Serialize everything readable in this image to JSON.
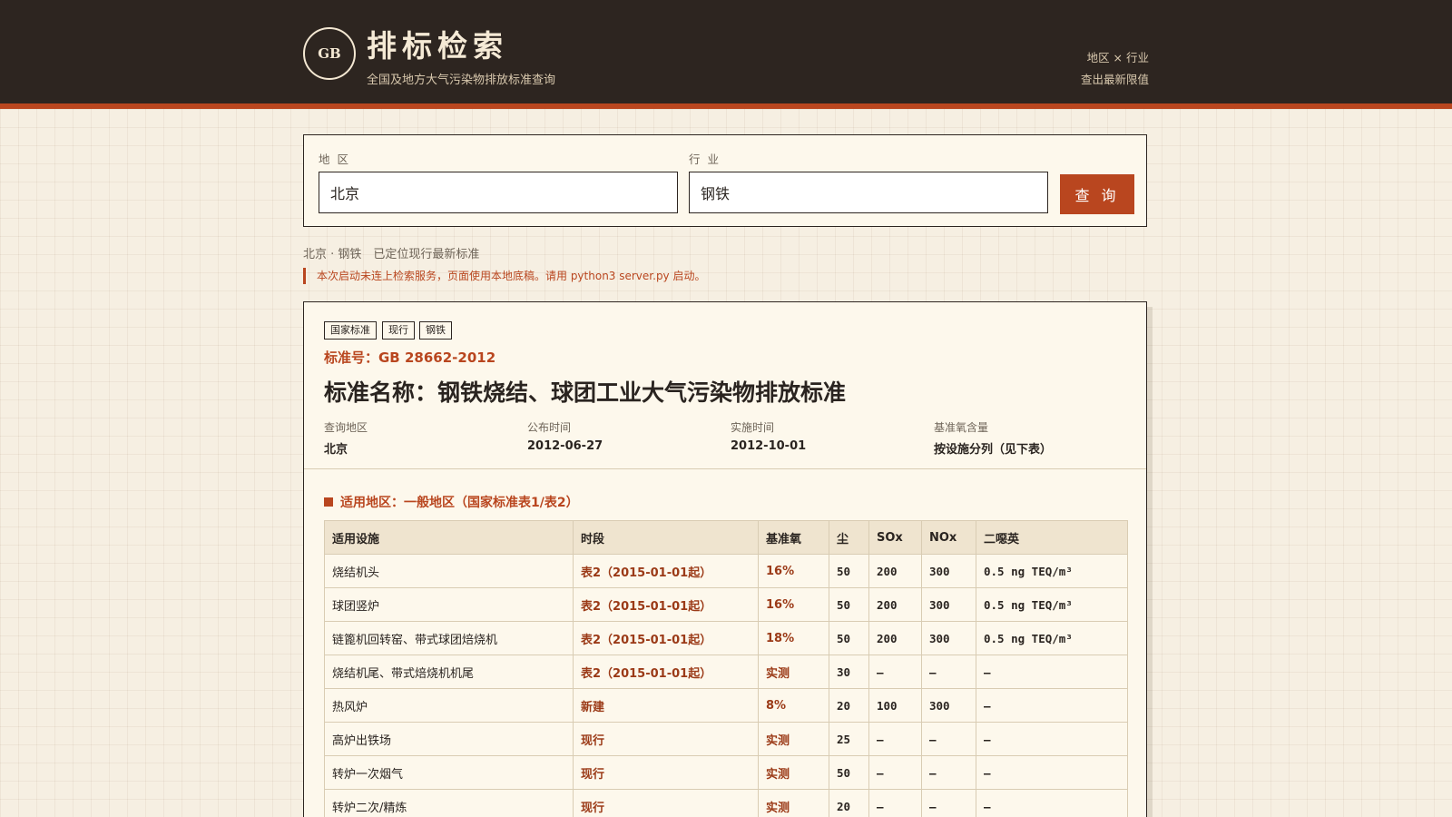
{
  "header": {
    "logo_text": "GB",
    "title": "排标检索",
    "subtitle": "全国及地方大气污染物排放标准查询",
    "tagline_line1": "地区 × 行业",
    "tagline_line2": "查出最新限值"
  },
  "search": {
    "region_label": "地 区",
    "region_value": "北京",
    "industry_label": "行 业",
    "industry_value": "钢铁",
    "button_label": "查 询"
  },
  "status": {
    "text": "北京 · 钢铁　已定位现行最新标准",
    "warning": "本次启动未连上检索服务，页面使用本地底稿。请用 python3 server.py 启动。"
  },
  "result": {
    "tags": [
      "国家标准",
      "现行",
      "钢铁"
    ],
    "code": "标准号：GB 28662-2012",
    "name": "标准名称：钢铁烧结、球团工业大气污染物排放标准",
    "meta": [
      {
        "key": "查询地区",
        "value": "北京"
      },
      {
        "key": "公布时间",
        "value": "2012-06-27"
      },
      {
        "key": "实施时间",
        "value": "2012-10-01"
      },
      {
        "key": "基准氧含量",
        "value": "按设施分列（见下表）"
      }
    ],
    "section_title": "适用地区：一般地区（国家标准表1/表2）",
    "table": {
      "headers": [
        "适用设施",
        "时段",
        "基准氧",
        "尘",
        "SOx",
        "NOx",
        "二噁英"
      ],
      "rows": [
        [
          "烧结机头",
          "表2（2015-01-01起）",
          "16%",
          "50",
          "200",
          "300",
          "0.5 ng TEQ/m³"
        ],
        [
          "球团竖炉",
          "表2（2015-01-01起）",
          "16%",
          "50",
          "200",
          "300",
          "0.5 ng TEQ/m³"
        ],
        [
          "链篦机回转窑、带式球团焙烧机",
          "表2（2015-01-01起）",
          "18%",
          "50",
          "200",
          "300",
          "0.5 ng TEQ/m³"
        ],
        [
          "烧结机尾、带式焙烧机机尾",
          "表2（2015-01-01起）",
          "实测",
          "30",
          "—",
          "—",
          "—"
        ],
        [
          "热风炉",
          "新建",
          "8%",
          "20",
          "100",
          "300",
          "—"
        ],
        [
          "高炉出铁场",
          "现行",
          "实测",
          "25",
          "—",
          "—",
          "—"
        ],
        [
          "转炉一次烟气",
          "现行",
          "实测",
          "50",
          "—",
          "—",
          "—"
        ],
        [
          "转炉二次/精炼",
          "现行",
          "实测",
          "20",
          "—",
          "—",
          "—"
        ]
      ]
    }
  }
}
